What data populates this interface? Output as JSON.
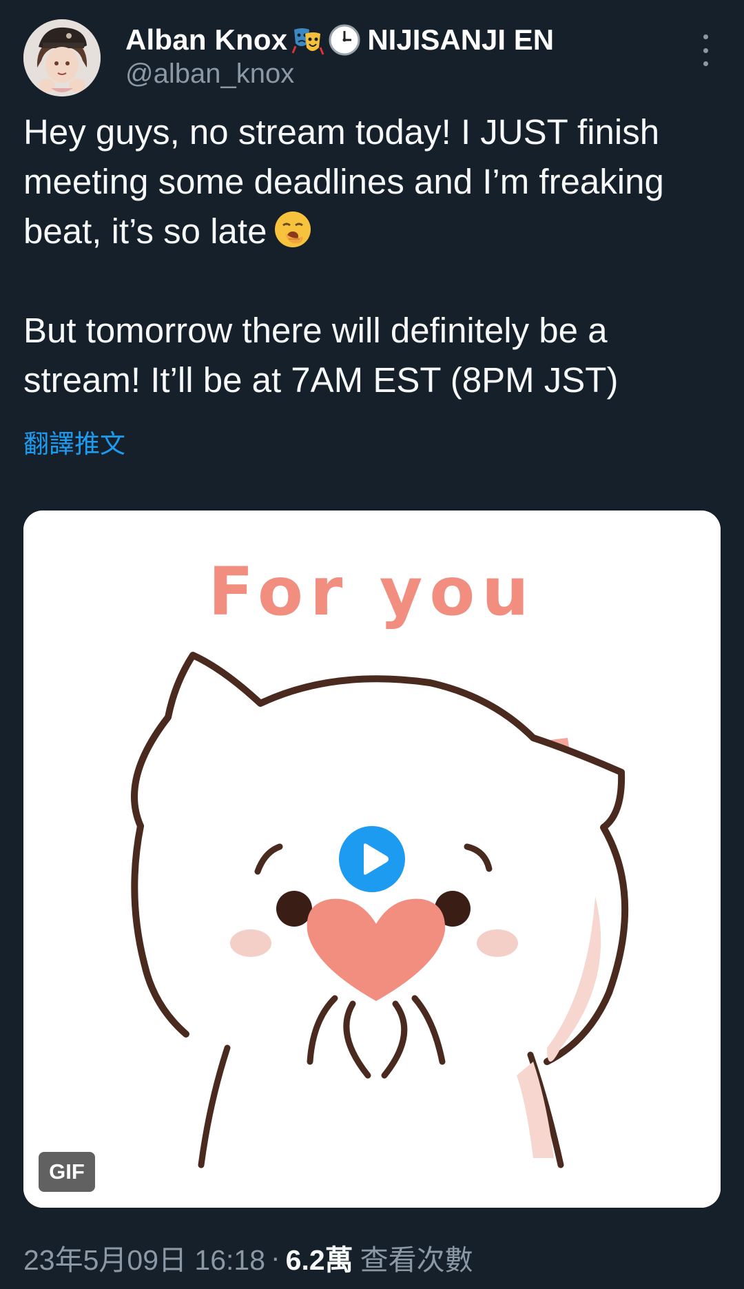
{
  "author": {
    "display_name": "Alban Knox",
    "name_suffix": "NIJISANJI EN",
    "handle": "@alban_knox",
    "name_emojis": [
      "performing-arts-icon",
      "clock-icon"
    ]
  },
  "tweet": {
    "paragraph_1": "Hey guys, no stream today! I JUST finish meeting some deadlines and I’m freaking beat, it’s so late",
    "paragraph_1_emoji": "yawning-face-icon",
    "paragraph_2": "But tomorrow there will definitely be a stream! It’ll be at 7AM EST (8PM JST)",
    "translate_label": "翻譯推文"
  },
  "media": {
    "type": "GIF",
    "caption_text": "For you",
    "badge": "GIF",
    "play_icon": "play-icon"
  },
  "meta": {
    "timestamp": "23年5月09日 16:18",
    "separator": "·",
    "views_count": "6.2萬",
    "views_label": "查看次數"
  },
  "colors": {
    "background": "#15202b",
    "text_primary": "#f7f9f9",
    "text_secondary": "#8b98a5",
    "accent": "#1d9bf0"
  }
}
